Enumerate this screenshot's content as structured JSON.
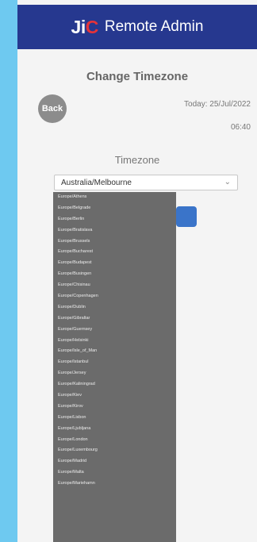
{
  "header": {
    "logo_mark_j": "J",
    "logo_mark_i": "i",
    "logo_mark_c": "C",
    "title": "Remote Admin"
  },
  "page": {
    "title": "Change Timezone",
    "back_label": "Back",
    "today": "Today: 25/Jul/2022",
    "time": "06:40"
  },
  "timezone": {
    "label": "Timezone",
    "selected": "Australia/Melbourne",
    "options": [
      "Europe/Athens",
      "Europe/Belgrade",
      "Europe/Berlin",
      "Europe/Bratislava",
      "Europe/Brussels",
      "Europe/Bucharest",
      "Europe/Budapest",
      "Europe/Busingen",
      "Europe/Chisinau",
      "Europe/Copenhagen",
      "Europe/Dublin",
      "Europe/Gibraltar",
      "Europe/Guernsey",
      "Europe/Helsinki",
      "Europe/Isle_of_Man",
      "Europe/Istanbul",
      "Europe/Jersey",
      "Europe/Kaliningrad",
      "Europe/Kiev",
      "Europe/Kirov",
      "Europe/Lisbon",
      "Europe/Ljubljana",
      "Europe/London",
      "Europe/Luxembourg",
      "Europe/Madrid",
      "Europe/Malta",
      "Europe/Mariehamn"
    ]
  },
  "colors": {
    "header_bg": "#26388f",
    "accent_red": "#e53339",
    "dropdown_bg": "#6b6b6b"
  }
}
